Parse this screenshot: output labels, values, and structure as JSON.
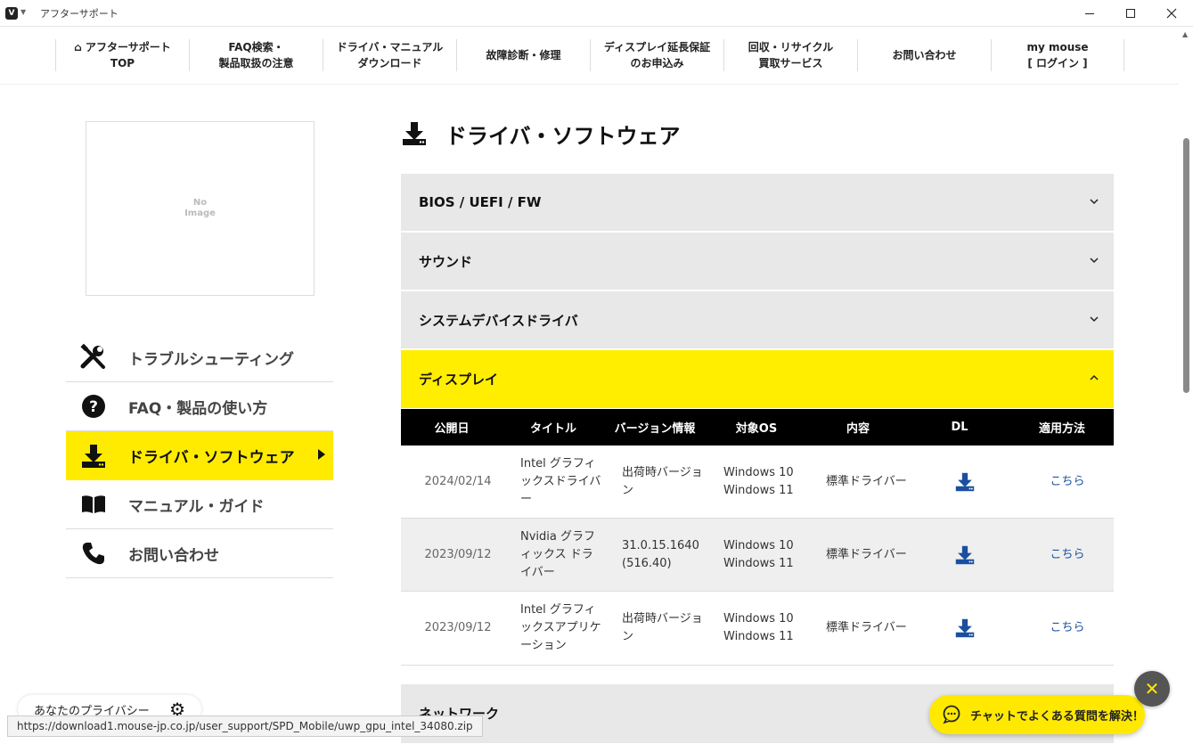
{
  "window": {
    "title": "アフターサポート",
    "app_icon_letter": "V"
  },
  "topnav": {
    "items": [
      {
        "label": "⌂ アフターサポート\nTOP"
      },
      {
        "label": "FAQ検索・\n製品取扱の注意"
      },
      {
        "label": "ドライバ・マニュアル\nダウンロード"
      },
      {
        "label": "故障診断・修理"
      },
      {
        "label": "ディスプレイ延長保証\nのお申込み"
      },
      {
        "label": "回収・リサイクル\n買取サービス"
      },
      {
        "label": "お問い合わせ"
      },
      {
        "label": "my mouse\n[ ログイン ]"
      }
    ]
  },
  "product_image": {
    "placeholder_text": "No\nImage"
  },
  "sidebar": {
    "items": [
      {
        "label": "トラブルシューティング",
        "icon": "tools-icon"
      },
      {
        "label": "FAQ・製品の使い方",
        "icon": "question-icon"
      },
      {
        "label": "ドライバ・ソフトウェア",
        "icon": "download-icon",
        "active": true
      },
      {
        "label": "マニュアル・ガイド",
        "icon": "book-icon"
      },
      {
        "label": "お問い合わせ",
        "icon": "phone-icon"
      }
    ]
  },
  "main": {
    "title": "ドライバ・ソフトウェア",
    "sections": [
      {
        "label": "BIOS / UEFI / FW",
        "expanded": false
      },
      {
        "label": "サウンド",
        "expanded": false
      },
      {
        "label": "システムデバイスドライバ",
        "expanded": false
      },
      {
        "label": "ディスプレイ",
        "expanded": true
      },
      {
        "label": "ネットワーク",
        "expanded": false
      }
    ],
    "table": {
      "headers": [
        "公開日",
        "タイトル",
        "バージョン情報",
        "対象OS",
        "内容",
        "DL",
        "適用方法"
      ],
      "rows": [
        {
          "date": "2024/02/14",
          "title": "Intel グラフィックスドライバー",
          "version": "出荷時バージョン",
          "os": "Windows 10\nWindows 11",
          "content": "標準ドライバー",
          "how": "こちら"
        },
        {
          "date": "2023/09/12",
          "title": "Nvidia グラフィックス ドライバー",
          "version": "31.0.15.1640 (516.40)",
          "os": "Windows 10\nWindows 11",
          "content": "標準ドライバー",
          "how": "こちら"
        },
        {
          "date": "2023/09/12",
          "title": "Intel グラフィックスアプリケーション",
          "version": "出荷時バージョン",
          "os": "Windows 10\nWindows 11",
          "content": "標準ドライバー",
          "how": "こちら"
        }
      ]
    }
  },
  "privacy": {
    "label": "あなたのプライバシー"
  },
  "status_url": "https://download1.mouse-jp.co.jp/user_support/SPD_Mobile/uwp_gpu_intel_34080.zip",
  "chat": {
    "label": "チャットでよくある質問を解決！",
    "close_symbol": "✕"
  },
  "colors": {
    "accent": "#ffeb00",
    "link": "#1a4fa0",
    "dl_icon": "#1a4fa0",
    "table_header": "#000000"
  }
}
